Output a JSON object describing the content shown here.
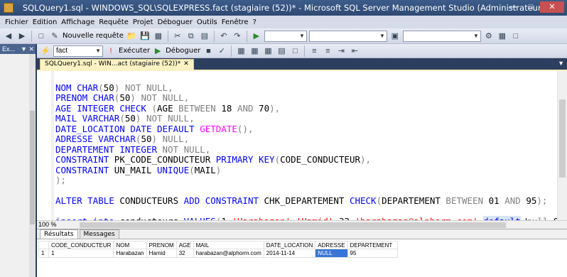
{
  "window": {
    "title": "SQLQuery1.sql - WINDOWS_SQL\\SQLEXPRESS.fact (stagiaire (52))* - Microsoft SQL Server Management Studio (Administrateur)"
  },
  "menu": [
    "Fichier",
    "Edition",
    "Affichage",
    "Requête",
    "Projet",
    "Déboguer",
    "Outils",
    "Fenêtre",
    "?"
  ],
  "toolbar": {
    "new_query_label": "Nouvelle requête",
    "database_value": "fact",
    "execute_label": "Exécuter",
    "debug_label": "Déboguer"
  },
  "object_explorer": {
    "title": "Ex..."
  },
  "tab": {
    "label": "SQLQuery1.sql - WIN...act (stagiaire (52))*"
  },
  "editor": {
    "zoom": "100 %"
  },
  "results": {
    "tabs": [
      "Résultats",
      "Messages"
    ],
    "columns": [
      "",
      "CODE_CONDUCTEUR",
      "NOM",
      "PRENOM",
      "AGE",
      "MAIL",
      "DATE_LOCATION",
      "ADRESSE",
      "DEPARTEMENT"
    ],
    "rows": [
      [
        "1",
        "1",
        "Harabazan",
        "Hamid",
        "32",
        "harabazan@alphorm.com",
        "2014-11-14",
        "NULL",
        "95"
      ]
    ]
  }
}
